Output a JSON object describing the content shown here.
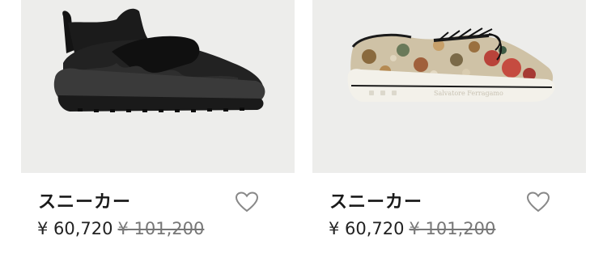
{
  "products": [
    {
      "name": "スニーカー",
      "sale_price": "¥ 60,720",
      "original_price": "¥ 101,200",
      "image": "black-slip-on-sneaker",
      "wishlist_icon": "heart-outline-icon"
    },
    {
      "name": "スニーカー",
      "sale_price": "¥ 60,720",
      "original_price": "¥ 101,200",
      "image": "floral-lace-up-sneaker",
      "wishlist_icon": "heart-outline-icon"
    }
  ],
  "colors": {
    "image_bg": "#ededeb",
    "text": "#1a1a1a",
    "strike": "#777777",
    "heart": "#888888"
  }
}
